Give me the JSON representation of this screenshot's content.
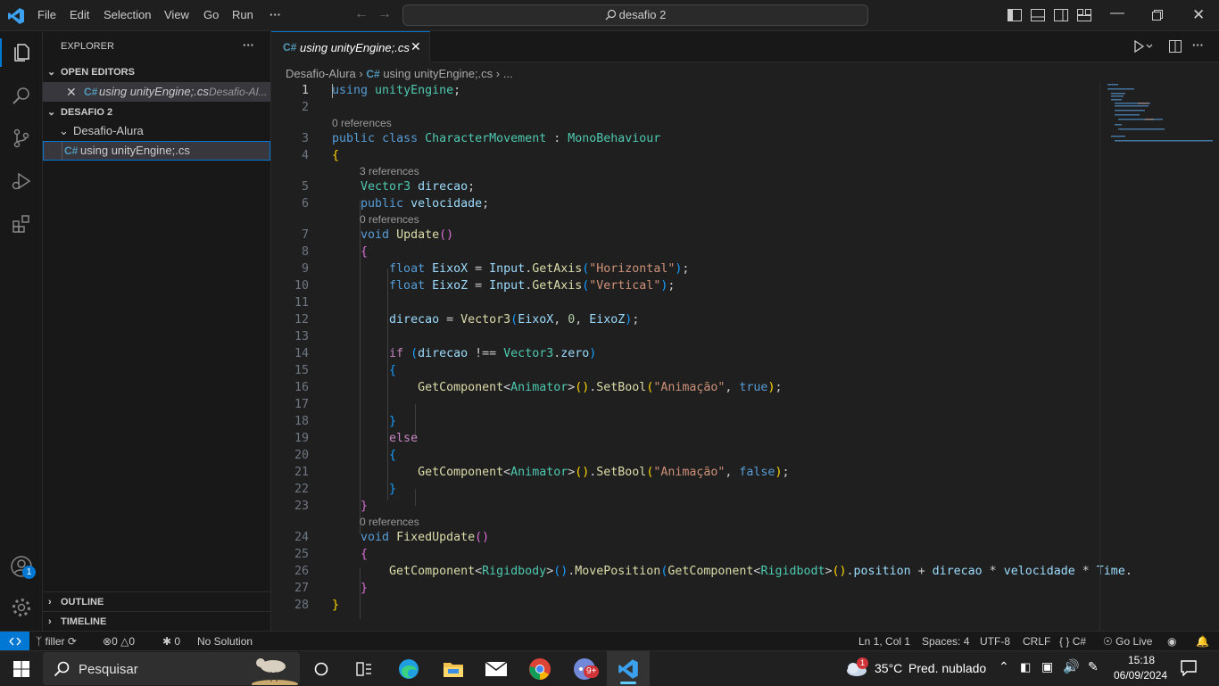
{
  "titlebar": {
    "menu": [
      "File",
      "Edit",
      "Selection",
      "View",
      "Go",
      "Run",
      "···"
    ],
    "search_text": "desafio 2"
  },
  "sidebar": {
    "title": "EXPLORER",
    "more": "···",
    "open_editors_label": "OPEN EDITORS",
    "open_file": "using unityEngine;.cs",
    "open_file_path": "Desafio-Al...",
    "workspace_label": "DESAFIO 2",
    "folder": "Desafio-Alura",
    "file": "using unityEngine;.cs",
    "outline_label": "OUTLINE",
    "timeline_label": "TIMELINE"
  },
  "activity_badge": "1",
  "editor": {
    "tab_label": "using unityEngine;.cs",
    "breadcrumb": {
      "folder": "Desafio-Alura",
      "file": "using unityEngine;.cs",
      "more": "..."
    },
    "lens": {
      "l3": "0 references",
      "l5": "3 references",
      "l7": "0 references",
      "l24": "0 references"
    }
  },
  "statusbar": {
    "branch": "filler",
    "errors": "0",
    "warnings": "0",
    "ports": "0",
    "solution": "No Solution",
    "cursor": "Ln 1, Col 1",
    "spaces": "Spaces: 4",
    "encoding": "UTF-8",
    "eol": "CRLF",
    "language": "C#",
    "golive": "Go Live"
  },
  "taskbar": {
    "search": "Pesquisar",
    "weather_temp": "35°C",
    "weather_desc": "Pred. nublado",
    "weather_badge": "1",
    "time": "15:18",
    "date": "06/09/2024",
    "discord_badge": "9+"
  },
  "colors": {
    "accent": "#0078d4",
    "keyword": "#569cd6",
    "type": "#4ec9b0",
    "function": "#dcdcaa",
    "string": "#ce9178"
  }
}
